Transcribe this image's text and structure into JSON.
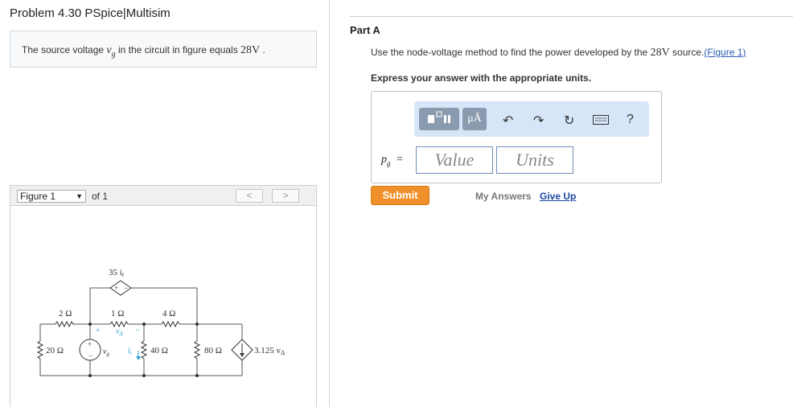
{
  "problem": {
    "title": "Problem 4.30 PSpice|Multisim",
    "statement_prefix": "The source voltage ",
    "var_v": "v",
    "var_g": "g",
    "statement_middle": " in the circuit in figure equals ",
    "statement_value": "28V",
    "statement_suffix": " ."
  },
  "figure": {
    "selector_label": "Figure 1",
    "of_label": "of 1",
    "prev": "<",
    "next": ">",
    "labels": {
      "dep_vsrc": "35 i",
      "dep_vsrc_sub": "t",
      "r1": "2 Ω",
      "r2": "1 Ω",
      "r3": "4 Ω",
      "r4": "20 Ω",
      "r5": "40 Ω",
      "r6": "80 Ω",
      "vdelta": "v",
      "vdelta_sub": "Δ",
      "vg": "v",
      "vg_sub": "g",
      "it": "i",
      "it_sub": "t",
      "dep_isrc": "3.125 v",
      "dep_isrc_sub": "Δ",
      "plus": "+",
      "minus": "−"
    }
  },
  "partA": {
    "heading": "Part A",
    "question_prefix": "Use the node-voltage method to find the power developed by the ",
    "question_value": "28V",
    "question_suffix": " source.",
    "figure_link": "(Figure 1)",
    "instructions": "Express your answer with the appropriate units.",
    "toolbar": {
      "units_label": "μÅ",
      "help_label": "?"
    },
    "answer_label": "p",
    "answer_sub": "g",
    "answer_eq": "=",
    "value_placeholder": "Value",
    "units_placeholder": "Units",
    "submit": "Submit",
    "my_answers": "My Answers",
    "give_up": "Give Up"
  },
  "colors": {
    "submit": "#f0902a",
    "toolbar_bg": "#d6e6f8",
    "link": "#1c4aa0",
    "circuit_blue": "#2a9fd6"
  }
}
